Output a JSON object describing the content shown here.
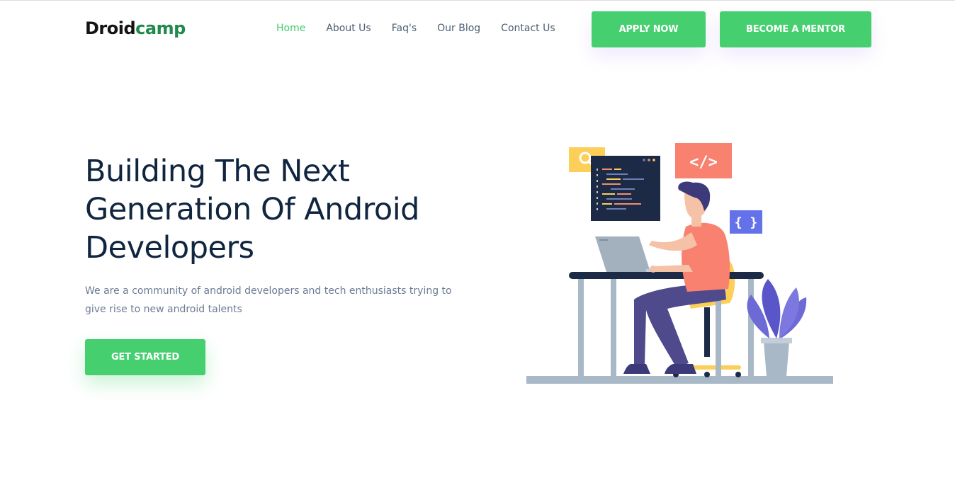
{
  "logo": {
    "part1": "Droid",
    "part2": "camp"
  },
  "nav": {
    "items": [
      {
        "label": "Home",
        "active": true
      },
      {
        "label": "About Us",
        "active": false
      },
      {
        "label": "Faq's",
        "active": false
      },
      {
        "label": "Our Blog",
        "active": false
      },
      {
        "label": "Contact Us",
        "active": false
      }
    ]
  },
  "header": {
    "apply_label": "APPLY NOW",
    "mentor_label": "BECOME A MENTOR"
  },
  "hero": {
    "title_line1": "Building The Next",
    "title_line2": "Generation Of Android",
    "title_line3": "Developers",
    "subtitle": "We are a community of android developers and tech enthusiasts trying to give rise to new android talents",
    "cta_label": "GET STARTED"
  },
  "illustration": {
    "code_tag": "</>",
    "braces_tag": "{ }",
    "icons": [
      "search-icon",
      "code-icon",
      "braces-icon"
    ]
  },
  "colors": {
    "accent": "#45cf6f",
    "nav_active": "#45cc6c",
    "heading": "#10253f",
    "text": "#6b7c93"
  }
}
